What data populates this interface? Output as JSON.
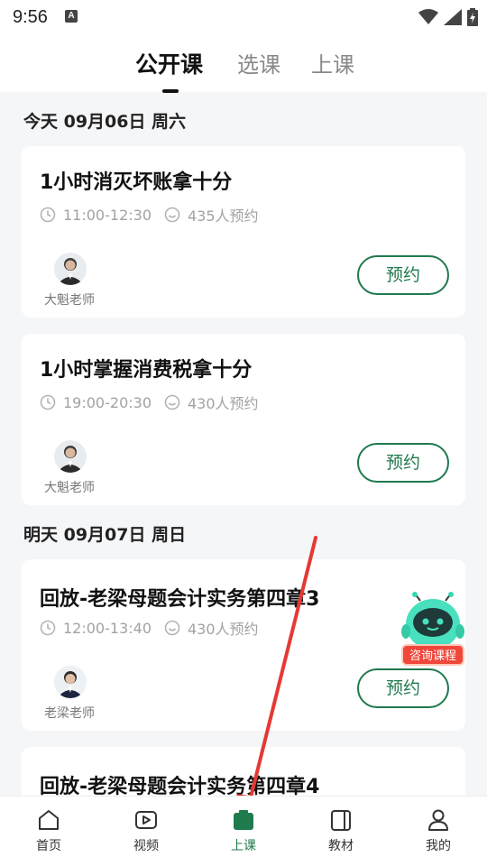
{
  "status_bar": {
    "time": "9:56",
    "notification_letter": "A"
  },
  "tabs": [
    {
      "label": "公开课",
      "active": true
    },
    {
      "label": "选课",
      "active": false
    },
    {
      "label": "上课",
      "active": false
    }
  ],
  "sections": [
    {
      "date": "今天 09月06日 周六",
      "courses": [
        {
          "title": "1小时消灭坏账拿十分",
          "time": "11:00-12:30",
          "reservations": "435人预约",
          "teacher": "大魁老师",
          "button": "预约"
        },
        {
          "title": "1小时掌握消费税拿十分",
          "time": "19:00-20:30",
          "reservations": "430人预约",
          "teacher": "大魁老师",
          "button": "预约"
        }
      ]
    },
    {
      "date": "明天 09月07日 周日",
      "courses": [
        {
          "title": "回放-老梁母题会计实务第四章3",
          "time": "12:00-13:40",
          "reservations": "430人预约",
          "teacher": "老梁老师",
          "button": "预约"
        },
        {
          "title": "回放-老梁母题会计实务第四章4"
        }
      ]
    }
  ],
  "consult": {
    "label": "咨询课程"
  },
  "bottom_nav": [
    {
      "label": "首页",
      "icon": "home-icon",
      "active": false
    },
    {
      "label": "视频",
      "icon": "video-icon",
      "active": false
    },
    {
      "label": "上课",
      "icon": "class-icon",
      "active": true
    },
    {
      "label": "教材",
      "icon": "book-icon",
      "active": false
    },
    {
      "label": "我的",
      "icon": "profile-icon",
      "active": false
    }
  ],
  "colors": {
    "accent": "#1f7a4d",
    "annotation_arrow": "#e53935",
    "consult_badge": "#f0473a"
  }
}
